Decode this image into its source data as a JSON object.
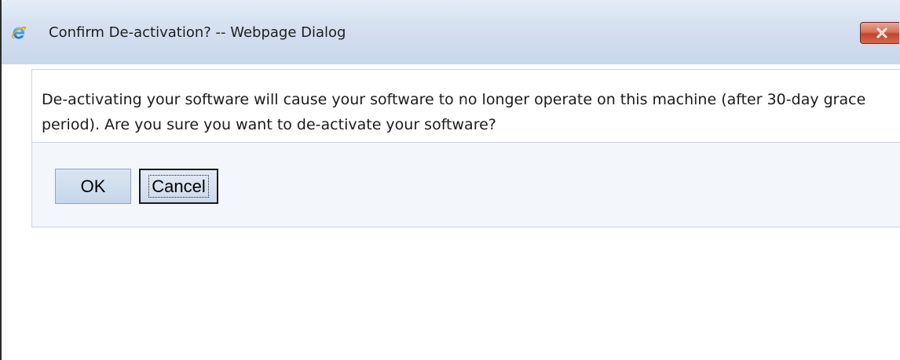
{
  "window": {
    "title": "Confirm De-activation? -- Webpage Dialog",
    "title_icon": "internet-explorer-icon",
    "close_icon": "close-icon",
    "close_button_color": "#c4432c"
  },
  "dialog": {
    "message": "De-activating your software will cause your software to no longer operate on this machine (after 30-day grace period). Are you sure you want to de-activate your software?",
    "ok_label": "OK",
    "cancel_label": "Cancel",
    "focused_button": "Cancel"
  }
}
